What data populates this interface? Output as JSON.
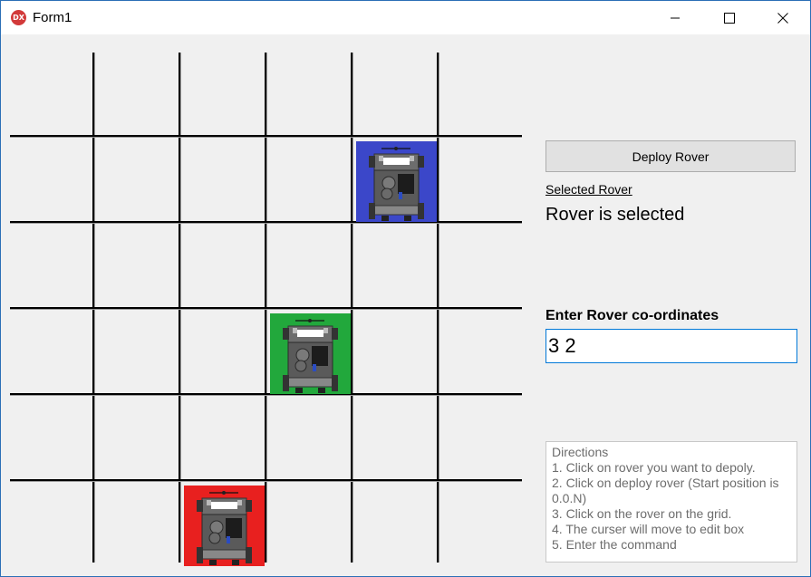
{
  "window": {
    "icon_text": "DX",
    "title": "Form1"
  },
  "grid": {
    "columns": 6,
    "rows": 6,
    "rovers": [
      {
        "color": "#3b47c9",
        "col": 4,
        "row": 1
      },
      {
        "color": "#22a83c",
        "col": 3,
        "row": 3
      },
      {
        "color": "#e8201f",
        "col": 2,
        "row": 5
      }
    ]
  },
  "panel": {
    "deploy_label": "Deploy Rover",
    "selected_link": "Selected Rover",
    "selected_status": "Rover is selected",
    "coords_label": "Enter Rover co-ordinates",
    "coords_value": "3 2",
    "directions": [
      "Directions",
      "1. Click on rover you want to depoly.",
      "2. Click on deploy rover (Start position is 0.0.N)",
      "3. Click on the rover on the grid.",
      "4. The curser will move to edit box",
      "5. Enter the command"
    ]
  },
  "icons": {
    "minimize": "minimize-icon",
    "maximize": "maximize-icon",
    "close": "close-icon"
  }
}
